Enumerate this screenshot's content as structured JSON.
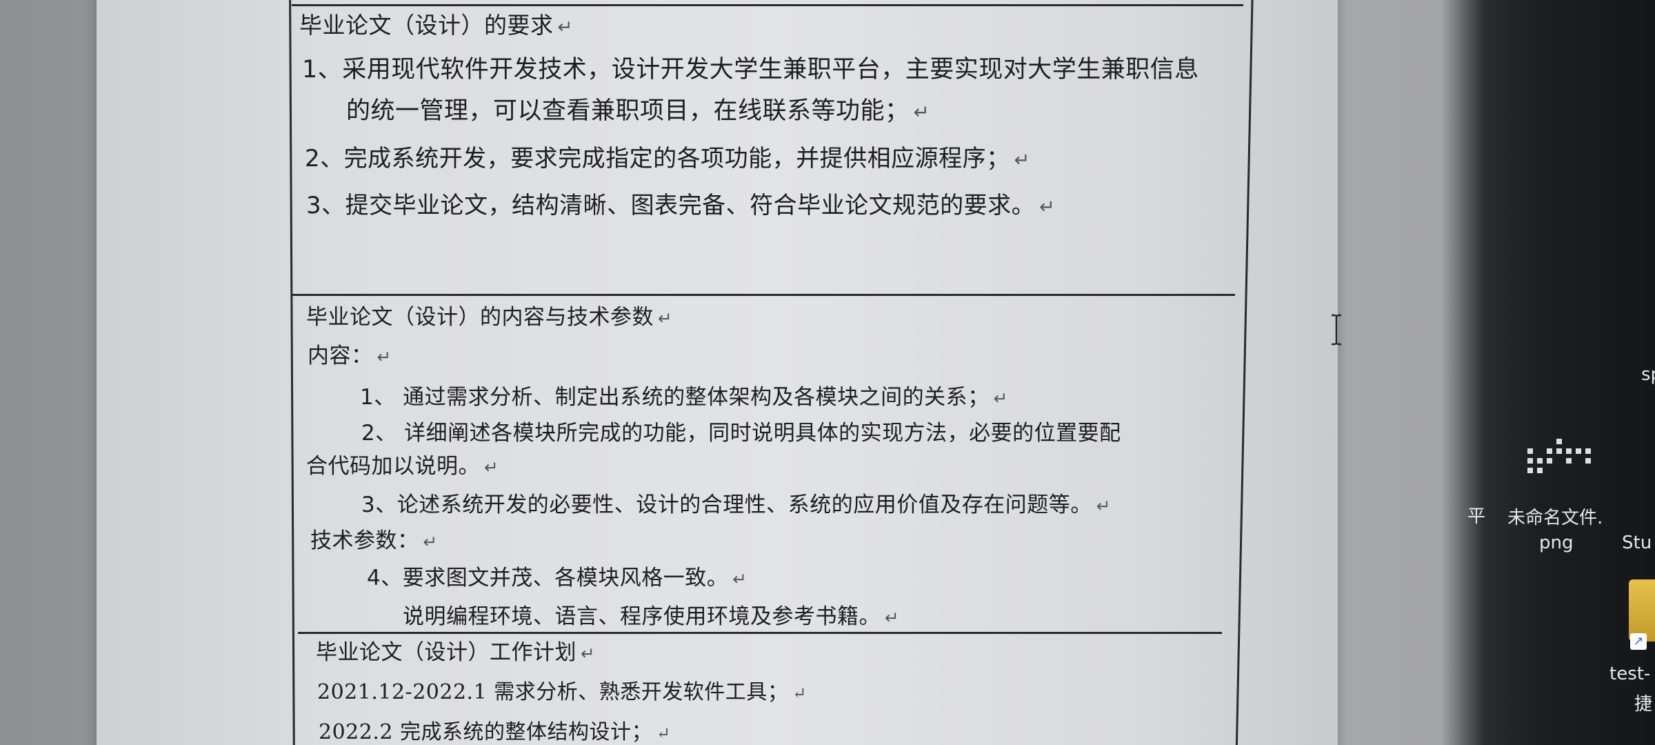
{
  "document": {
    "section1": {
      "title": "毕业论文（设计）的要求",
      "item1_line1": "1、采用现代软件开发技术，设计开发大学生兼职平台，主要实现对大学生兼职信息",
      "item1_line2": "的统一管理，可以查看兼职项目，在线联系等功能；",
      "item2": "2、完成系统开发，要求完成指定的各项功能，并提供相应源程序；",
      "item3": "3、提交毕业论文，结构清晰、图表完备、符合毕业论文规范的要求。"
    },
    "section2": {
      "title": "毕业论文（设计）的内容与技术参数",
      "content_label": "内容：",
      "c1": "1、 通过需求分析、制定出系统的整体架构及各模块之间的关系；",
      "c2_line1": "2、 详细阐述各模块所完成的功能，同时说明具体的实现方法，必要的位置要配",
      "c2_line2": "合代码加以说明。",
      "c3": "3、论述系统开发的必要性、设计的合理性、系统的应用价值及存在问题等。",
      "tech_label": "技术参数：",
      "t4": "4、要求图文并茂、各模块风格一致。",
      "t5": "说明编程环境、语言、程序使用环境及参考书籍。"
    },
    "section3": {
      "title": "毕业论文（设计）工作计划",
      "plan1": "2021.12-2022.1 需求分析、熟悉开发软件工具；",
      "plan2": "2022.2 完成系统的整体结构设计；"
    },
    "return_mark": "↵"
  },
  "desktop": {
    "label_sp": "sp",
    "label_ping": "平",
    "file_name_line1": "未命名文件.",
    "file_name_line2": "png",
    "label_stu": "Stu",
    "shortcut_line1": "test-",
    "shortcut_line2": "捷"
  },
  "colors": {
    "text": "#1e1e1e",
    "table_border": "#2a2a2a",
    "paper": "#e2e3e5",
    "desktop": "#1d1e21"
  },
  "icons": {
    "cursor": "text-ibeam-icon",
    "shortcut": "shortcut-arrow-icon",
    "file": "image-file-icon"
  }
}
